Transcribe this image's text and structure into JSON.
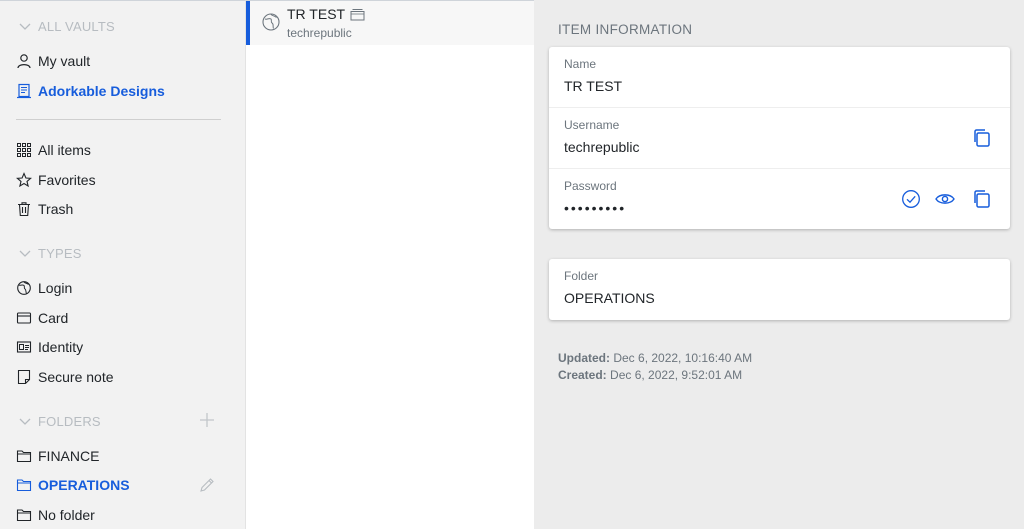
{
  "sidebar": {
    "all_vaults": "ALL VAULTS",
    "vaults": [
      {
        "label": "My vault"
      },
      {
        "label": "Adorkable Designs"
      }
    ],
    "items": [
      {
        "label": "All items"
      },
      {
        "label": "Favorites"
      },
      {
        "label": "Trash"
      }
    ],
    "types_head": "TYPES",
    "types": [
      {
        "label": "Login"
      },
      {
        "label": "Card"
      },
      {
        "label": "Identity"
      },
      {
        "label": "Secure note"
      }
    ],
    "folders_head": "FOLDERS",
    "folders": [
      {
        "label": "FINANCE"
      },
      {
        "label": "OPERATIONS"
      },
      {
        "label": "No folder"
      }
    ]
  },
  "list": {
    "items": [
      {
        "title": "TR TEST",
        "subtitle": "techrepublic"
      }
    ]
  },
  "detail": {
    "header": "ITEM INFORMATION",
    "name_label": "Name",
    "name_value": "TR TEST",
    "username_label": "Username",
    "username_value": "techrepublic",
    "password_label": "Password",
    "password_value": "•••••••••",
    "folder_label": "Folder",
    "folder_value": "OPERATIONS",
    "updated_label": "Updated:",
    "updated_value": "Dec 6, 2022, 10:16:40 AM",
    "created_label": "Created:",
    "created_value": "Dec 6, 2022, 9:52:01 AM"
  },
  "colors": {
    "accent": "#175ddc",
    "sidebar_bg": "#f2f2f2",
    "detail_bg": "#ececec"
  }
}
